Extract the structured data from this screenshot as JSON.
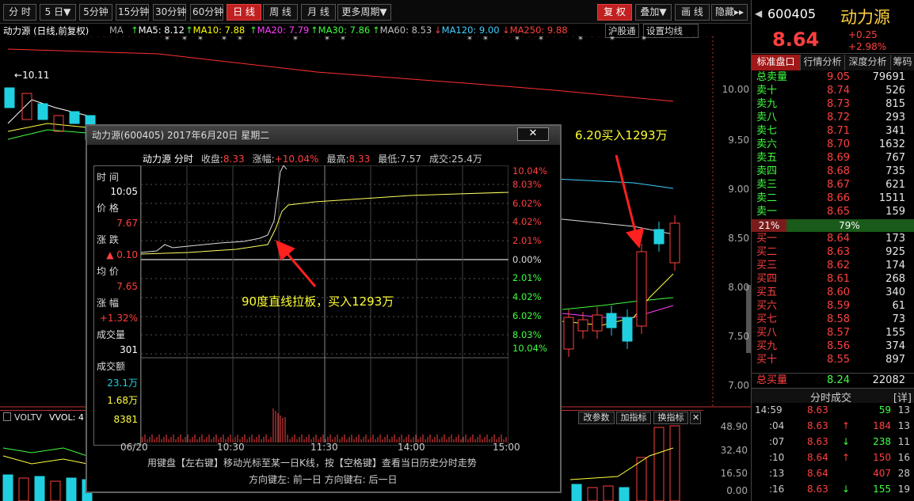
{
  "toolbar": {
    "tabs": [
      "分 时",
      "5 日▼",
      "5分钟",
      "15分钟",
      "30分钟",
      "60分钟",
      "日 线",
      "周 线",
      "月 线",
      "更多周期▼"
    ],
    "right": [
      "复 权",
      "叠加▼",
      "画 线",
      "隐藏▸▸"
    ]
  },
  "ma": {
    "name": "动力源 (日线,前复权)",
    "ma_label": "MA",
    "items": [
      {
        "label": "MA5: 8.12",
        "color": "#ffffff"
      },
      {
        "label": "MA10: 7.88",
        "color": "#ffff00"
      },
      {
        "label": "MA20: 7.79",
        "color": "#ff40ff"
      },
      {
        "label": "MA30: 7.86",
        "color": "#40ff40"
      },
      {
        "label": "MA60: 8.53",
        "color": "#c0c0c0"
      },
      {
        "label": "MA120: 9.00",
        "color": "#40d0ff"
      },
      {
        "label": "MA250: 9.88",
        "color": "#ff4040"
      }
    ],
    "btn1": "沪股通",
    "btn2": "设置均线"
  },
  "chart_data": {
    "type": "candlestick",
    "high_label": "10.11",
    "y_ticks": [
      "10.00",
      "9.50",
      "9.00",
      "8.50",
      "8.00",
      "7.50",
      "7.00"
    ],
    "vol_ticks": [
      "48.90",
      "32.40",
      "16.50",
      "0.00"
    ]
  },
  "vol": {
    "label": "VOLTV",
    "vvol": "VVOL: 4",
    "btns": [
      "改参数",
      "加指标",
      "换指标",
      "✕"
    ]
  },
  "popup": {
    "title": "动力源(600405) 2017年6月20日 星期二",
    "close": "✕",
    "header": [
      "动力源 分时",
      "收盘:",
      "8.33",
      "涨幅:",
      "+10.04%",
      "最高:",
      "8.33",
      "最低:",
      "7.57",
      "成交:25.4万"
    ],
    "left": {
      "time_l": "时 间",
      "time_v": "10:05",
      "price_l": "价 格",
      "price_v": "7.67",
      "chg_l": "涨 跌",
      "chg_v": "▲ 0.10",
      "avg_l": "均 价",
      "avg_v": "7.65",
      "pct_l": "涨 幅",
      "pct_v": "+1.32%",
      "vol_l": "成交量",
      "vol_v": "301",
      "amt_l": "成交额",
      "amt_v": "23.1万"
    },
    "pct_ticks": [
      "10.04%",
      "8.03%",
      "6.02%",
      "4.02%",
      "2.01%",
      "0.00%",
      "2.01%",
      "4.02%",
      "6.02%",
      "8.03%",
      "10.04%"
    ],
    "vol_axis": [
      "1.68万",
      "8381"
    ],
    "x_ticks": [
      "06/20",
      "10:30",
      "11:30",
      "14:00",
      "15:00"
    ],
    "help1": "用键盘【左右键】移动光标至某一日K线，按【空格键】查看当日历史分时走势",
    "help2": "方向键左: 前一日    方向键右: 后一日"
  },
  "annot": {
    "a1": "6.20买入1293万",
    "a2": "90度直线拉板，买入1293万"
  },
  "quote": {
    "code": "600405",
    "name": "动力源",
    "price": "8.64",
    "chg": "+0.25",
    "pct": "+2.98%",
    "tabs": [
      "标准盘口",
      "行情分析",
      "深度分析",
      "筹码"
    ],
    "total_sell_l": "总卖量",
    "total_sell_p": "9.05",
    "total_sell_v": "79691",
    "asks": [
      [
        "卖十",
        "8.74",
        "526"
      ],
      [
        "卖九",
        "8.73",
        "815"
      ],
      [
        "卖八",
        "8.72",
        "293"
      ],
      [
        "卖七",
        "8.71",
        "341"
      ],
      [
        "卖六",
        "8.70",
        "1632"
      ],
      [
        "卖五",
        "8.69",
        "767"
      ],
      [
        "卖四",
        "8.68",
        "735"
      ],
      [
        "卖三",
        "8.67",
        "621"
      ],
      [
        "卖二",
        "8.66",
        "1511"
      ],
      [
        "卖一",
        "8.65",
        "159"
      ]
    ],
    "ratio_l": "21%",
    "ratio_r": "79%",
    "bids": [
      [
        "买一",
        "8.64",
        "173"
      ],
      [
        "买二",
        "8.63",
        "925"
      ],
      [
        "买三",
        "8.62",
        "174"
      ],
      [
        "买四",
        "8.61",
        "268"
      ],
      [
        "买五",
        "8.60",
        "340"
      ],
      [
        "买六",
        "8.59",
        "61"
      ],
      [
        "买七",
        "8.58",
        "73"
      ],
      [
        "买八",
        "8.57",
        "155"
      ],
      [
        "买九",
        "8.56",
        "374"
      ],
      [
        "买十",
        "8.55",
        "897"
      ]
    ],
    "total_buy_l": "总买量",
    "total_buy_p": "8.24",
    "total_buy_v": "22082",
    "trades_title": "分时成交",
    "detail": "[详]",
    "trades": [
      [
        "14:59",
        "8.63",
        "",
        "59",
        "13"
      ],
      [
        ":04",
        "8.63",
        "↑",
        "184",
        "13"
      ],
      [
        ":07",
        "8.63",
        "↓",
        "238",
        "11"
      ],
      [
        ":10",
        "8.64",
        "↑",
        "150",
        "16"
      ],
      [
        ":13",
        "8.64",
        "",
        "407",
        "28"
      ],
      [
        ":16",
        "8.63",
        "↓",
        "155",
        "19"
      ]
    ]
  }
}
